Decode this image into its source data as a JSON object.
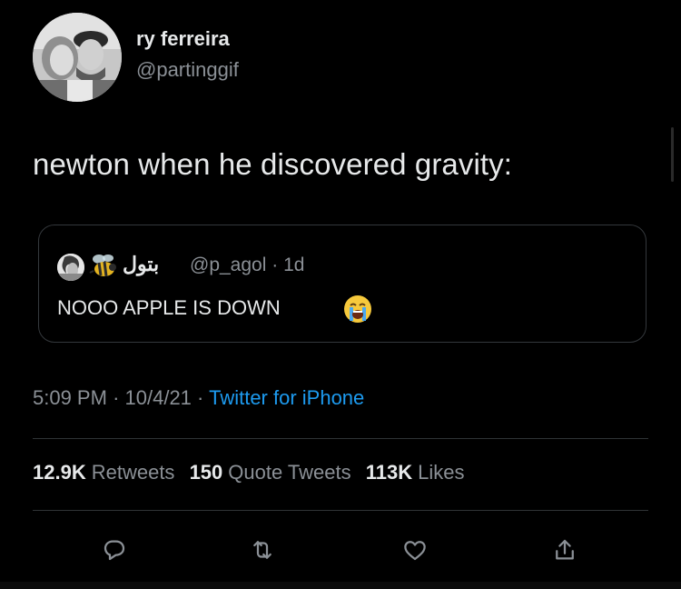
{
  "tweet": {
    "author": {
      "display_name": "ry ferreira",
      "handle": "@partinggif",
      "avatar_icon": "profile-photo"
    },
    "text": "newton when he discovered gravity:",
    "quoted_tweet": {
      "display_name": "بتول",
      "handle": "@p_agol",
      "age": "1d",
      "meta_separator": "·",
      "text": "NOOO APPLE IS DOWN",
      "emoji_icon": "loudly-crying-face",
      "badge_icon": "bee"
    },
    "timestamp": {
      "time": "5:09 PM",
      "date": "10/4/21",
      "separator": "·",
      "source": "Twitter for iPhone"
    },
    "stats": {
      "retweets_count": "12.9K",
      "retweets_label": "Retweets",
      "quotes_count": "150",
      "quotes_label": "Quote Tweets",
      "likes_count": "113K",
      "likes_label": "Likes"
    },
    "actions": {
      "reply_icon": "reply-icon",
      "retweet_icon": "retweet-icon",
      "like_icon": "heart-icon",
      "share_icon": "share-icon"
    }
  },
  "theme": {
    "background": "#000000",
    "text_primary": "#e7e9ea",
    "text_secondary": "#8b9096",
    "link": "#1d9bf0",
    "border": "#2f3336"
  }
}
